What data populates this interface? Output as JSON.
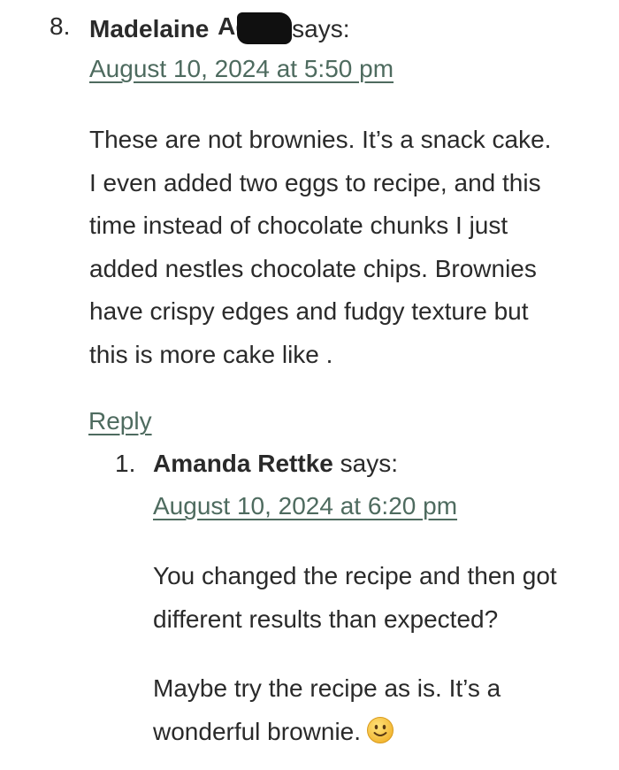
{
  "comments": [
    {
      "number": "8.",
      "author": "Madelaine",
      "author_redacted_visible": "Ad",
      "says": "says:",
      "date": "August 10, 2024 at 5:50 pm",
      "body_lines": [
        "These are not brownies. It’s a snack cake.",
        "I even added two eggs to recipe, and this",
        "time instead of chocolate chunks I just",
        "added nestles chocolate chips. Brownies",
        "have crispy edges and fudgy texture but",
        "this is more cake like ."
      ],
      "reply_label": "Reply"
    }
  ],
  "replies": [
    {
      "number": "1.",
      "author": "Amanda Rettke",
      "says": "says:",
      "date": "August 10, 2024 at 6:20 pm",
      "paragraph1_lines": [
        "You changed the recipe and then got",
        "different results than expected?"
      ],
      "paragraph2_lines": [
        "Maybe try the recipe as is. It’s a",
        "wonderful brownie."
      ],
      "emoji": "slightly-smiling-face-icon"
    }
  ],
  "colors": {
    "link": "#4e6b5f",
    "text": "#2a2a2a",
    "emoji_face": "#f7c948"
  }
}
